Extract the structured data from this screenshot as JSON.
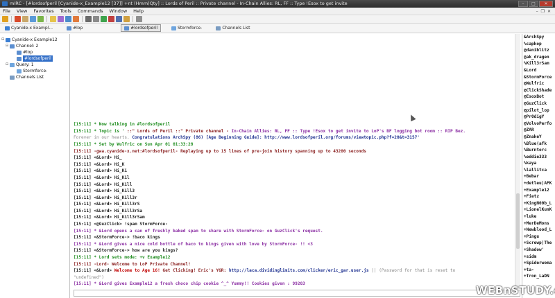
{
  "window": {
    "title": "mIRC - [#lordsofperil [Cyanide-x_Example12 [37]] +nt (Hmm)Qty] :: Lords of Peril :: Private channel - In-Chain Allies: RL, FF :: Type !Esox to get invite"
  },
  "menu": [
    "File",
    "View",
    "Favorites",
    "Tools",
    "Commands",
    "Window",
    "Help"
  ],
  "switchbar": [
    {
      "label": "Cyanide-x Exampl...",
      "active": false,
      "color": "#3b7fd4"
    },
    {
      "label": "#lop",
      "active": false,
      "color": "#5b8ed0"
    },
    {
      "label": "#lordsofperil",
      "active": true,
      "color": "#5b8ed0"
    },
    {
      "label": "Stormforce-",
      "active": false,
      "color": "#6ea5de"
    },
    {
      "label": "Channels List",
      "active": false,
      "color": "#7a9cc2"
    }
  ],
  "tree": [
    {
      "label": "Cyanide-x Example12",
      "expander": "⊟",
      "color": "#3b7fd4",
      "indent": 2,
      "selected": false
    },
    {
      "label": "Channel: 2",
      "expander": "⊟",
      "color": "#5b8ed0",
      "indent": 8,
      "selected": false
    },
    {
      "label": "#lop",
      "expander": "",
      "color": "#5b8ed0",
      "indent": 18,
      "selected": false
    },
    {
      "label": "#lordsofperil",
      "expander": "",
      "color": "#5b8ed0",
      "indent": 18,
      "selected": true
    },
    {
      "label": "Query: 1",
      "expander": "⊟",
      "color": "#6ea5de",
      "indent": 8,
      "selected": false
    },
    {
      "label": "Stormforce-",
      "expander": "",
      "color": "#6ea5de",
      "indent": 18,
      "selected": false
    },
    {
      "label": "Channels List",
      "expander": "",
      "color": "#7a9cc2",
      "indent": 8,
      "selected": false
    }
  ],
  "chat_lines": [
    [
      {
        "t": "[15:11] * Now talking in #lordsofperil",
        "c": "c-green"
      }
    ],
    [
      {
        "t": "[15:11] * Topic is '",
        "c": "c-green"
      },
      {
        "t": " ::\" Lords of Peril ::\" Private channel - ",
        "c": "c-darkred"
      },
      {
        "t": "In-Chain Allies: RL, FF :: ",
        "c": "c-purple"
      },
      {
        "t": "Type !Esox to get invite to LoP's BF logging bot room :: RIP Bez.",
        "c": "c-purple"
      }
    ],
    [
      {
        "t": " Forever in our hearts. ",
        "c": "c-gray"
      },
      {
        "t": "Congratulations ArchSpy (86) [Age Beginning Guide]: http://www.lordsofperil.org/forums/viewtopic.php?f=20&t=3157'",
        "c": "c-navy"
      }
    ],
    [
      {
        "t": "[15:11] * Set by Wulfric on Sun Apr 01 01:33:28",
        "c": "c-green"
      }
    ],
    [
      {
        "t": "[15:11] -gwa.cyanide-x.net:#lordsofperil- Replaying up to 15 lines of pre-join history spanning up to 43200 seconds",
        "c": "c-darkred"
      }
    ],
    [
      {
        "t": "[15:11] <&Lord> Hi_",
        "c": "c-black"
      }
    ],
    [
      {
        "t": "[15:11] <&Lord> Hi_K",
        "c": "c-black"
      }
    ],
    [
      {
        "t": "[15:11] <&Lord> Hi_Ki",
        "c": "c-black"
      }
    ],
    [
      {
        "t": "[15:11] <&Lord> Hi_Kil",
        "c": "c-black"
      }
    ],
    [
      {
        "t": "[15:11] <&Lord> Hi_Kill",
        "c": "c-black"
      }
    ],
    [
      {
        "t": "[15:11] <&Lord> Hi_Kill3",
        "c": "c-black"
      }
    ],
    [
      {
        "t": "[15:11] <&Lord> Hi_Kill3r",
        "c": "c-black"
      }
    ],
    [
      {
        "t": "[15:11] <&Lord> Hi_Kill3rS",
        "c": "c-black"
      }
    ],
    [
      {
        "t": "[15:11] <&Lord> Hi_Kill3rSa",
        "c": "c-black"
      }
    ],
    [
      {
        "t": "[15:11] <&Lord> Hi_Kill3rSam",
        "c": "c-black"
      }
    ],
    [
      {
        "t": "[15:11] <@GuzClick> !spam StormForce-",
        "c": "c-black"
      }
    ],
    [
      {
        "t": "[15:11] * &Lord opens a can of freshly baked spam to share with StormForce- on GuzClick's request.",
        "c": "c-purple"
      }
    ],
    [
      {
        "t": "[15:11] <&StormForce-> !baco kings",
        "c": "c-black"
      }
    ],
    [
      {
        "t": "[15:11] * &Lord gives a nice cold bottle of baco to kings given with love by StormForce- !! <3",
        "c": "c-purple"
      }
    ],
    [
      {
        "t": "[15:11] <&StormForce-> how are you kings?",
        "c": "c-black"
      }
    ],
    [
      {
        "t": "[15:11] * Lord sets mode: +v Example12",
        "c": "c-green"
      }
    ],
    [
      {
        "t": "[15:11] -Lord- Welcome to LoP Private Channel!",
        "c": "c-darkred"
      }
    ],
    [
      {
        "t": "[15:11] <&Lord> ",
        "c": "c-black"
      },
      {
        "t": "Welcome to Age 16!",
        "c": "c-red"
      },
      {
        "t": " Get Clicking! Eric's YGR: ",
        "c": "c-darkred"
      },
      {
        "t": "http://laca.dividinglimits.com/clicker/eric_gar.user.js",
        "c": "c-navy"
      },
      {
        "t": " || (Password for that is reset to",
        "c": "c-gray"
      }
    ],
    [
      {
        "t": " \"undefined\")",
        "c": "c-gray"
      }
    ],
    [
      {
        "t": "[15:11] * &Lord gives Example12 a fresh choco chip cookie ^_^ Yummy!! Cookies given : 99203",
        "c": "c-purple"
      }
    ]
  ],
  "nicklist": [
    "&ArchSpy",
    "%capkop",
    "@daniblitz",
    "@ak_dragen",
    "%Kill3rSam",
    "&Lord",
    "&StormForce",
    "@Wulfric",
    "@ClickShade",
    "@EsoxBot",
    "@GuzClick",
    "@pilot_lop",
    "@Pr0digY",
    "@VolvoPerfo",
    "@ZAR",
    "@ZnakeY",
    "%Blue(afk",
    "%Burntorc",
    "%eddie333",
    "%kaya",
    "%lallitca",
    "+Bebar",
    "+detleu|AFK",
    "+Example12",
    "+Fietz",
    "+KingN00b_L",
    "+LionelKunK",
    "+luke",
    "+MerDeMons",
    "+Newblood_L",
    "+Pingu",
    "+Screwp|The",
    "+Shadow'",
    "+sidm",
    "+Spiderwoma",
    "+ta-",
    "+Tron_LaDN"
  ],
  "watermark": "WEBnSTUDY.com"
}
